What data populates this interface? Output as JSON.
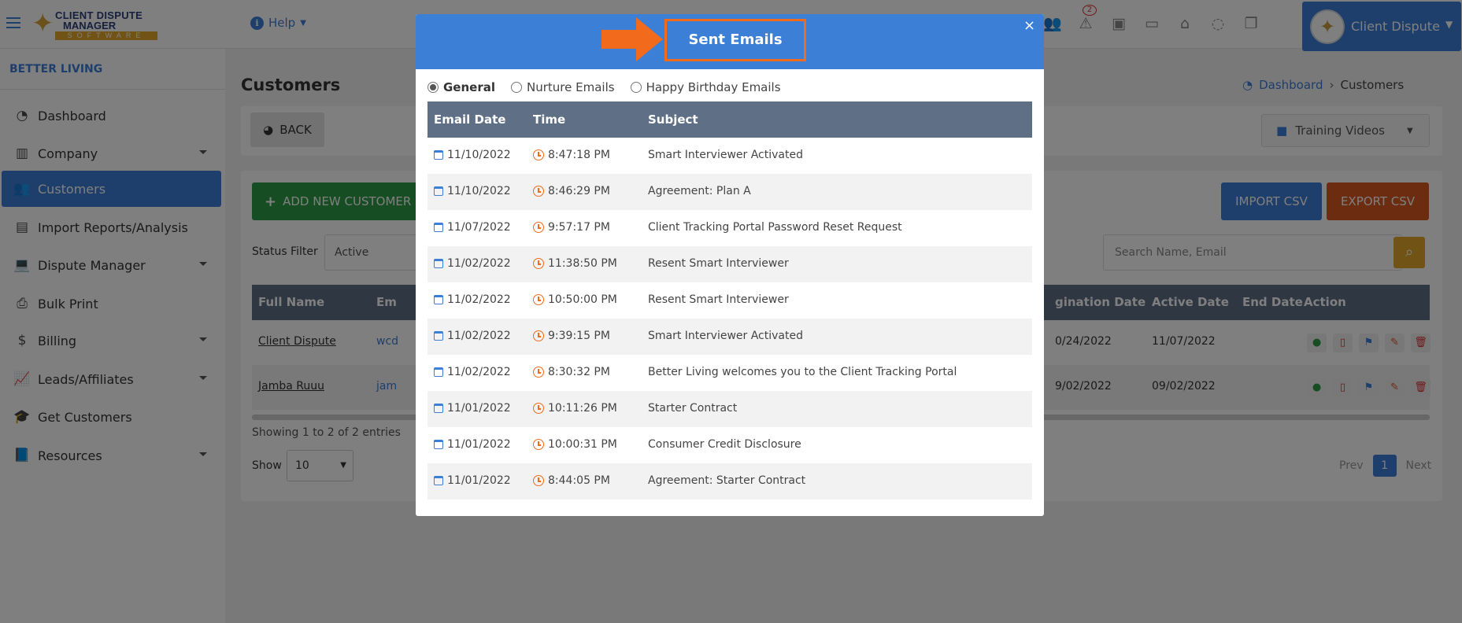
{
  "topbar": {
    "logo_line1": "CLIENT DISPUTE",
    "logo_line2": "MANAGER",
    "logo_line3": "SOFTWARE",
    "help_label": "Help",
    "user_name": "Client Dispute",
    "icon_badge_count": "2"
  },
  "sidebar": {
    "company_name": "BETTER LIVING",
    "items": [
      {
        "label": "Dashboard",
        "icon": "pie-chart-icon"
      },
      {
        "label": "Company",
        "icon": "building-icon"
      },
      {
        "label": "Customers",
        "icon": "users-icon"
      },
      {
        "label": "Import Reports/Analysis",
        "icon": "file-icon"
      },
      {
        "label": "Dispute Manager",
        "icon": "laptop-icon"
      },
      {
        "label": "Bulk Print",
        "icon": "print-icon"
      },
      {
        "label": "Billing",
        "icon": "invoice-icon"
      },
      {
        "label": "Leads/Affiliates",
        "icon": "chart-line-icon"
      },
      {
        "label": "Get Customers",
        "icon": "graduation-cap-icon"
      },
      {
        "label": "Resources",
        "icon": "book-icon"
      }
    ]
  },
  "main": {
    "page_title": "Customers",
    "breadcrumb": {
      "home": "Dashboard",
      "current": "Customers"
    },
    "back_label": "BACK",
    "training_label": "Training Videos",
    "add_customer_label": "ADD NEW CUSTOMER",
    "import_label": "IMPORT CSV",
    "export_label": "EXPORT CSV",
    "status_filter_label": "Status Filter",
    "status_filter_value": "Active",
    "search_placeholder": "Search Name, Email",
    "table": {
      "col_fullname": "Full Name",
      "col_email": "Em",
      "col_origination": "gination Date",
      "col_active": "Active Date",
      "col_end": "End Date",
      "col_action": "Action",
      "rows": [
        {
          "name": "Client Dispute",
          "email": "wcd",
          "origination": "0/24/2022",
          "active": "11/07/2022"
        },
        {
          "name": "Jamba Ruuu",
          "email": "jam",
          "origination": "9/02/2022",
          "active": "09/02/2022"
        }
      ]
    },
    "showing_text": "Showing 1 to 2 of 2 entries",
    "show_label": "Show",
    "show_value": "10",
    "pager": {
      "prev": "Prev",
      "page": "1",
      "next": "Next"
    }
  },
  "modal": {
    "title": "Sent Emails",
    "close": "×",
    "tabs": [
      "General",
      "Nurture Emails",
      "Happy Birthday Emails"
    ],
    "selected_tab": "General",
    "columns": {
      "date": "Email Date",
      "time": "Time",
      "subject": "Subject"
    },
    "rows": [
      {
        "date": "11/10/2022",
        "time": "8:47:18 PM",
        "subject": "Smart Interviewer Activated"
      },
      {
        "date": "11/10/2022",
        "time": "8:46:29 PM",
        "subject": "Agreement: Plan A"
      },
      {
        "date": "11/07/2022",
        "time": "9:57:17 PM",
        "subject": "Client Tracking Portal Password Reset Request"
      },
      {
        "date": "11/02/2022",
        "time": "11:38:50 PM",
        "subject": "Resent Smart Interviewer"
      },
      {
        "date": "11/02/2022",
        "time": "10:50:00 PM",
        "subject": "Resent Smart Interviewer"
      },
      {
        "date": "11/02/2022",
        "time": "9:39:15 PM",
        "subject": "Smart Interviewer Activated"
      },
      {
        "date": "11/02/2022",
        "time": "8:30:32 PM",
        "subject": "Better Living welcomes you to the Client Tracking Portal"
      },
      {
        "date": "11/01/2022",
        "time": "10:11:26 PM",
        "subject": "Starter Contract"
      },
      {
        "date": "11/01/2022",
        "time": "10:00:31 PM",
        "subject": "Consumer Credit Disclosure"
      },
      {
        "date": "11/01/2022",
        "time": "8:44:05 PM",
        "subject": "Agreement: Starter Contract"
      }
    ]
  },
  "colors": {
    "primary": "#3c7fd6",
    "success": "#2c9a46",
    "danger": "#d9581f",
    "warning": "#e3a62c",
    "table_header": "#5f6f86",
    "highlight": "#f26b1d"
  }
}
